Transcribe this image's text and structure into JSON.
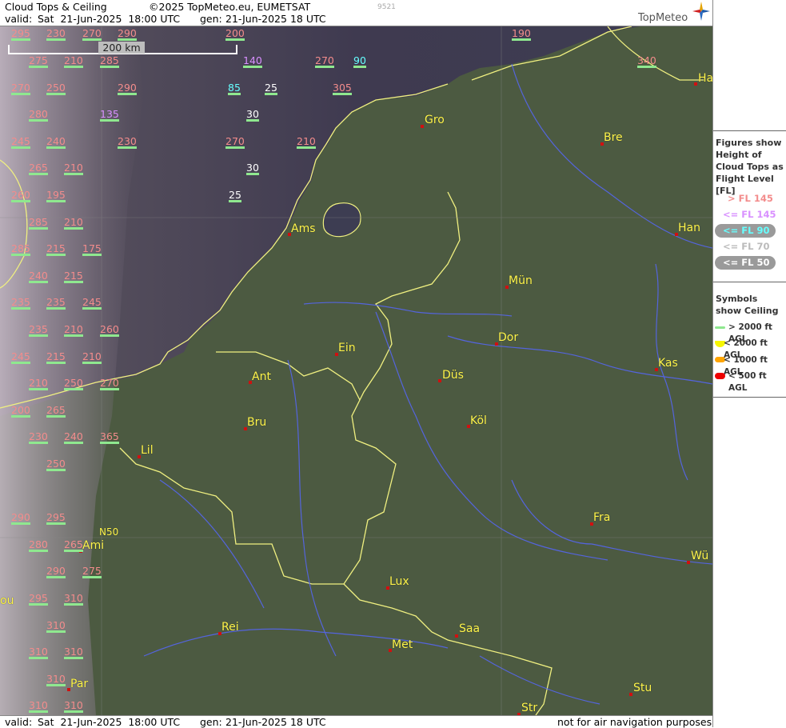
{
  "header": {
    "title": "Cloud Tops & Ceiling",
    "copyright": "©2025 TopMeteo.eu, EUMETSAT",
    "id_code": "9521",
    "valid_label": "valid:",
    "valid_value": "Sat  21-Jun-2025  18:00 UTC",
    "gen_label": "gen:",
    "gen_value": "21-Jun-2025 18 UTC",
    "logo_text": "TopMeteo"
  },
  "footer": {
    "valid_label": "valid:",
    "valid_value": "Sat  21-Jun-2025  18:00 UTC",
    "gen_label": "gen:",
    "gen_value": "21-Jun-2025 18 UTC",
    "disclaimer": "not for air navigation purposes"
  },
  "scale_label": "200 km",
  "lat_label": "N50",
  "legend": {
    "tops_title": "Figures show Height of Cloud Tops as Flight Level  [FL]",
    "tops_items": [
      {
        "label": "> FL 145",
        "color": "#f38c8c",
        "pill": false
      },
      {
        "label": "<= FL 145",
        "color": "#d890ff",
        "pill": false
      },
      {
        "label": "<= FL 90",
        "color": "#66ffff",
        "pill": true
      },
      {
        "label": "<= FL 70",
        "color": "#bbbbbb",
        "pill": false
      },
      {
        "label": "<= FL 50",
        "color": "#ffffff",
        "pill": true
      }
    ],
    "ceiling_title": "Symbols show Ceiling",
    "ceiling_items": [
      {
        "label": "> 2000 ft AGL",
        "color": "#8fe88f"
      },
      {
        "label": "< 2000 ft AGL",
        "color": "#f6f600"
      },
      {
        "label": "< 1000 ft AGL",
        "color": "#ffa500"
      },
      {
        "label": "< 500 ft AGL",
        "color": "#ee0000"
      }
    ]
  },
  "cities": [
    "Ha",
    "Gro",
    "Bre",
    "Ams",
    "Han",
    "Mün",
    "Ein",
    "Dor",
    "Ant",
    "Düs",
    "Kas",
    "Bru",
    "Köl",
    "Lil",
    "Fra",
    "Ami",
    "Wü",
    "Lux",
    "Rei",
    "Saa",
    "Met",
    "Stu",
    "Par",
    "Str",
    "ou"
  ],
  "cloud_tops": [
    "295",
    "230",
    "270",
    "290",
    "200",
    "190",
    "275",
    "210",
    "285",
    "140",
    "270",
    "90",
    "340",
    "270",
    "250",
    "290",
    "85",
    "25",
    "305",
    "280",
    "135",
    "30",
    "245",
    "240",
    "230",
    "270",
    "210",
    "265",
    "210",
    "30",
    "260",
    "195",
    "25",
    "285",
    "210",
    "285",
    "215",
    "175",
    "240",
    "215",
    "235",
    "235",
    "245",
    "235",
    "210",
    "260",
    "245",
    "215",
    "210",
    "210",
    "250",
    "270",
    "200",
    "265",
    "230",
    "240",
    "365",
    "250",
    "290",
    "295",
    "280",
    "265",
    "290",
    "275",
    "295",
    "310",
    "310",
    "310",
    "310",
    "310",
    "310",
    "310"
  ]
}
